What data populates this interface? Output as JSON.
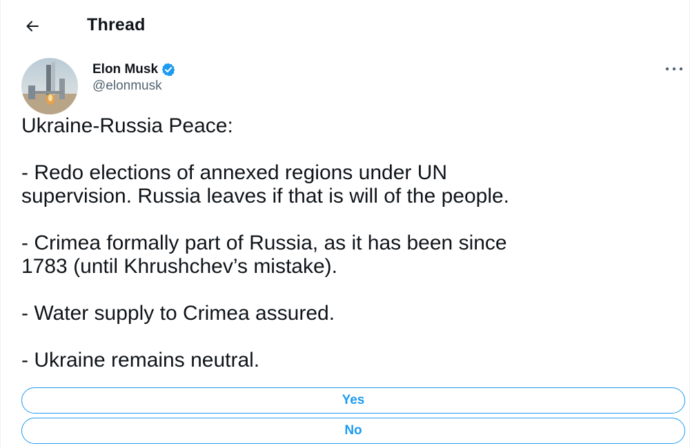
{
  "header": {
    "back_icon": "arrow-left-icon",
    "title": "Thread"
  },
  "author": {
    "name": "Elon Musk",
    "handle": "@elonmusk",
    "verified_icon": "verified-badge-icon",
    "verified_color": "#1d9bf0"
  },
  "more_icon": "more-horizontal-icon",
  "tweet": {
    "paragraphs": [
      [
        "Ukraine-Russia Peace:"
      ],
      [
        "- Redo elections of annexed regions under UN",
        "supervision. Russia leaves if that is will of the people."
      ],
      [
        "- Crimea formally part of Russia, as it has been since",
        "1783 (until Khrushchev’s mistake)."
      ],
      [
        "- Water supply to Crimea assured."
      ],
      [
        "- Ukraine remains neutral."
      ]
    ]
  },
  "poll": {
    "options": [
      {
        "label": "Yes"
      },
      {
        "label": "No"
      }
    ],
    "accent_color": "#1d9bf0"
  }
}
